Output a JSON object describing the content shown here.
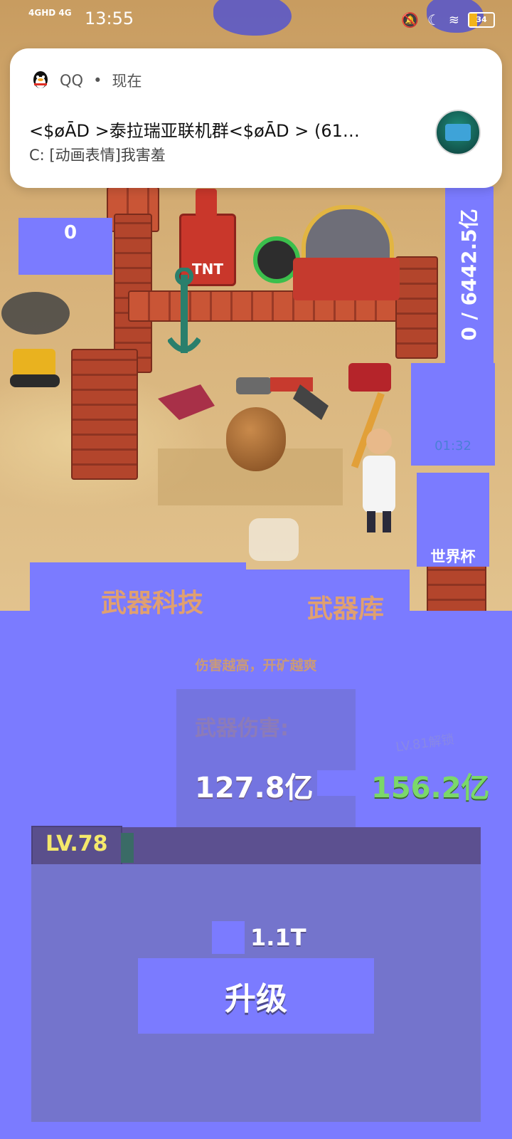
{
  "statusbar": {
    "network": "4GHD 4G",
    "time": "13:55",
    "battery": "34"
  },
  "notification": {
    "app_name": "QQ",
    "separator": "•",
    "when": "现在",
    "title": "<$øĀD >泰拉瑞亚联机群<$øĀD > (61…",
    "body": "C: [动画表情]我害羞"
  },
  "game": {
    "counter": "0",
    "progress": "0 / 6442.5亿",
    "timer": "01:32",
    "event_label": "世界杯"
  },
  "panel": {
    "tabs": [
      "武器科技",
      "武器库"
    ],
    "subtitle": "伤害越高，开矿越爽",
    "damage_label": "武器伤害:",
    "damage_current": "127.8亿",
    "damage_next": "156.2亿",
    "unlock_note": "LV.81解锁",
    "level": "LV.78",
    "level_progress": 0.03,
    "cost": "1.1T",
    "upgrade_label": "升级"
  }
}
